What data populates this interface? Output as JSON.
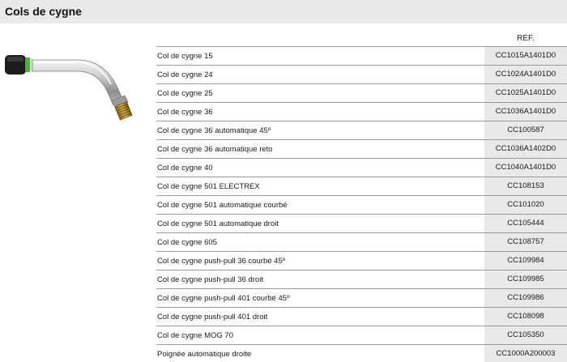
{
  "header": {
    "title": "Cols de cygne"
  },
  "table": {
    "ref_header": "REF.",
    "rows": [
      {
        "name": "Col de cygne 15",
        "ref": "CC1015A1401D0"
      },
      {
        "name": "Col de cygne 24",
        "ref": "CC1024A1401D0"
      },
      {
        "name": "Col de cygne 25",
        "ref": "CC1025A1401D0"
      },
      {
        "name": "Col de cygne 36",
        "ref": "CC1036A1401D0"
      },
      {
        "name": "Col de cygne 36 automatique 45º",
        "ref": "CC100587"
      },
      {
        "name": "Col de cygne 36 automatique reto",
        "ref": "CC1036A1402D0"
      },
      {
        "name": "Col de cygne 40",
        "ref": "CC1040A1401D0"
      },
      {
        "name": "Col de cygne 501 ELECTREX",
        "ref": "CC108153"
      },
      {
        "name": "Col de cygne 501 automatique courbé",
        "ref": "CC101020"
      },
      {
        "name": "Col de cygne 501 automatique droit",
        "ref": "CC105444"
      },
      {
        "name": "Col de cygne 605",
        "ref": "CC108757"
      },
      {
        "name": "Col de cygne push-pull 36 courbé 45º",
        "ref": "CC109984"
      },
      {
        "name": "Col de cygne push-pull 36 droit",
        "ref": "CC109985"
      },
      {
        "name": "Col de cygne push-pull 401 courbé 45º",
        "ref": "CC109986"
      },
      {
        "name": "Col de cygne push-pull 401 droit",
        "ref": "CC108098"
      },
      {
        "name": "Col de cygne MOG 70",
        "ref": "CC105350"
      },
      {
        "name": "Poignée automatique droite",
        "ref": "CC1000A200003"
      }
    ]
  },
  "colors": {
    "header_bg": "#e9e9e9",
    "ref_cell_bg": "#e9e9e9",
    "row_border": "#9a9a9a",
    "accent_green": "#4caf3a"
  },
  "image": {
    "icon": "swan-neck-torch-icon"
  }
}
